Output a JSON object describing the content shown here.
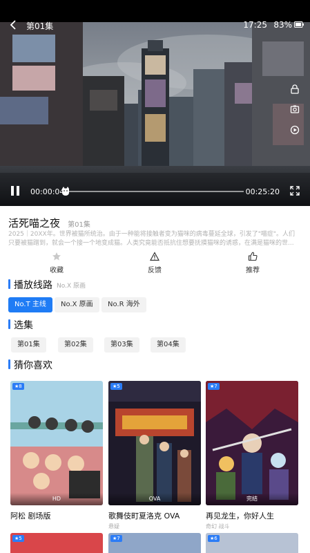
{
  "player": {
    "back_icon": "chevron-left-icon",
    "episode_title": "第01集",
    "clock": "17:25",
    "battery": "83%",
    "current_time": "00:00:04",
    "duration": "00:25:20",
    "progress": 0.0026
  },
  "show": {
    "title": "活死喵之夜",
    "episode_tag": "第01集",
    "synopsis": "2025｜20XX年。世界被猫所统治。由于一种能将接触者变为猫咪的病毒蔓延全球，引发了\"喵症\"。人们只要被猫蹭到，就会一个接一个地变成猫。人类究竟能否抵抗住想要抚摸猫咪的诱惑，在满是猫咪的世..."
  },
  "actions": [
    {
      "label": "收藏",
      "icon": "star-icon"
    },
    {
      "label": "反馈",
      "icon": "warning-icon"
    },
    {
      "label": "推荐",
      "icon": "thumbs-up-icon"
    }
  ],
  "routes": {
    "heading": "播放线路",
    "subheading": "No.X 原画",
    "items": [
      {
        "label": "No.T 主线",
        "active": true
      },
      {
        "label": "No.X 原画",
        "active": false
      },
      {
        "label": "No.R 海外",
        "active": false
      }
    ]
  },
  "episodes": {
    "heading": "选集",
    "items": [
      "第01集",
      "第02集",
      "第03集",
      "第04集"
    ]
  },
  "recommend": {
    "heading": "猜你喜欢",
    "items": [
      {
        "title": "阿松 剧场版",
        "sub": "",
        "badge": "HD",
        "rating": "★8"
      },
      {
        "title": "歌舞伎町夏洛克 OVA",
        "sub": "悬疑",
        "badge": "OVA",
        "rating": "★5"
      },
      {
        "title": "再见龙生，你好人生",
        "sub": "奇幻 战斗",
        "badge": "完结",
        "rating": "★7"
      }
    ],
    "peek_ratings": [
      "★5",
      "★7",
      "★6"
    ]
  },
  "colors": {
    "accent": "#1f7cf5",
    "section_bar": "#2b7cf6"
  }
}
